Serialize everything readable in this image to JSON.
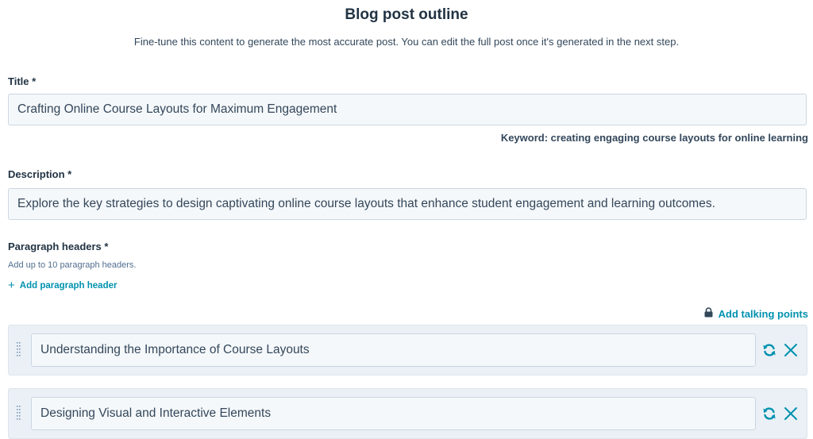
{
  "header": {
    "title": "Blog post outline",
    "subtitle": "Fine-tune this content to generate the most accurate post. You can edit the full post once it's generated in the next step."
  },
  "form": {
    "title_label": "Title *",
    "title_value": "Crafting Online Course Layouts for Maximum Engagement",
    "keyword": "Keyword: creating engaging course layouts for online learning",
    "description_label": "Description *",
    "description_value": "Explore the key strategies to design captivating online course layouts that enhance student engagement and learning outcomes.",
    "paragraph_headers_label": "Paragraph headers *",
    "paragraph_headers_helper": "Add up to 10 paragraph headers.",
    "add_paragraph_header_label": "Add paragraph header",
    "add_talking_points_label": "Add talking points",
    "paragraph_headers": [
      {
        "value": "Understanding the Importance of Course Layouts"
      },
      {
        "value": "Designing Visual and Interactive Elements"
      }
    ]
  },
  "colors": {
    "accent": "#0091ae",
    "text": "#33475b",
    "field_bg": "#f5f8fa",
    "row_bg": "#eaf0f6"
  },
  "icons": {
    "plus": "plus-icon",
    "lock": "lock-icon",
    "drag": "drag-handle-icon",
    "regenerate": "refresh-icon",
    "remove": "close-icon"
  }
}
